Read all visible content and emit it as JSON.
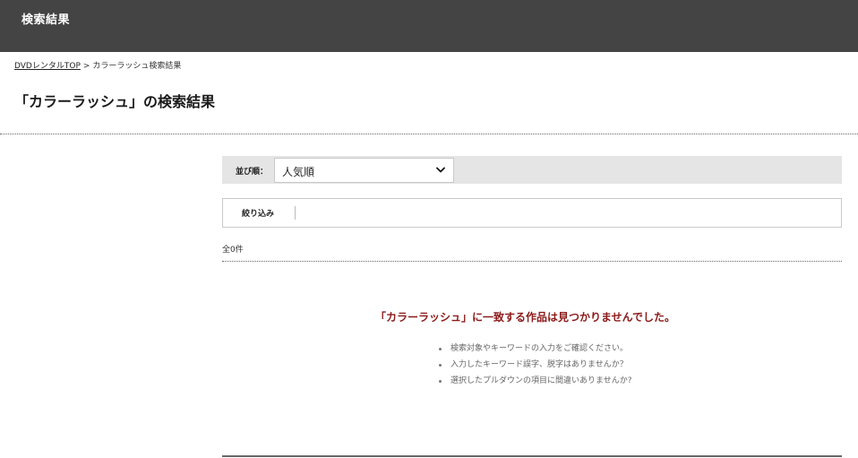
{
  "header": {
    "title": "検索結果"
  },
  "breadcrumb": {
    "home_link": "DVDレンタルTOP",
    "separator": ">",
    "current": "カラーラッシュ検索結果"
  },
  "page": {
    "title": "「カラーラッシュ」の検索結果"
  },
  "sort": {
    "label": "並び順：",
    "selected": "人気順"
  },
  "filter": {
    "label": "絞り込み"
  },
  "results": {
    "count": "全0件",
    "no_result_message": "「カラーラッシュ」に一致する作品は見つかりませんでした。",
    "hints": [
      "検索対象やキーワードの入力をご確認ください。",
      "入力したキーワード誤字、脱字はありませんか？",
      "選択したプルダウンの項目に間違いありませんか?"
    ]
  },
  "colors": {
    "header_bg": "#444444",
    "no_result_text": "#8b1a1a",
    "sort_bar_bg": "#e5e5e5"
  },
  "icons": {
    "select_arrow": "chevron-down-icon"
  }
}
